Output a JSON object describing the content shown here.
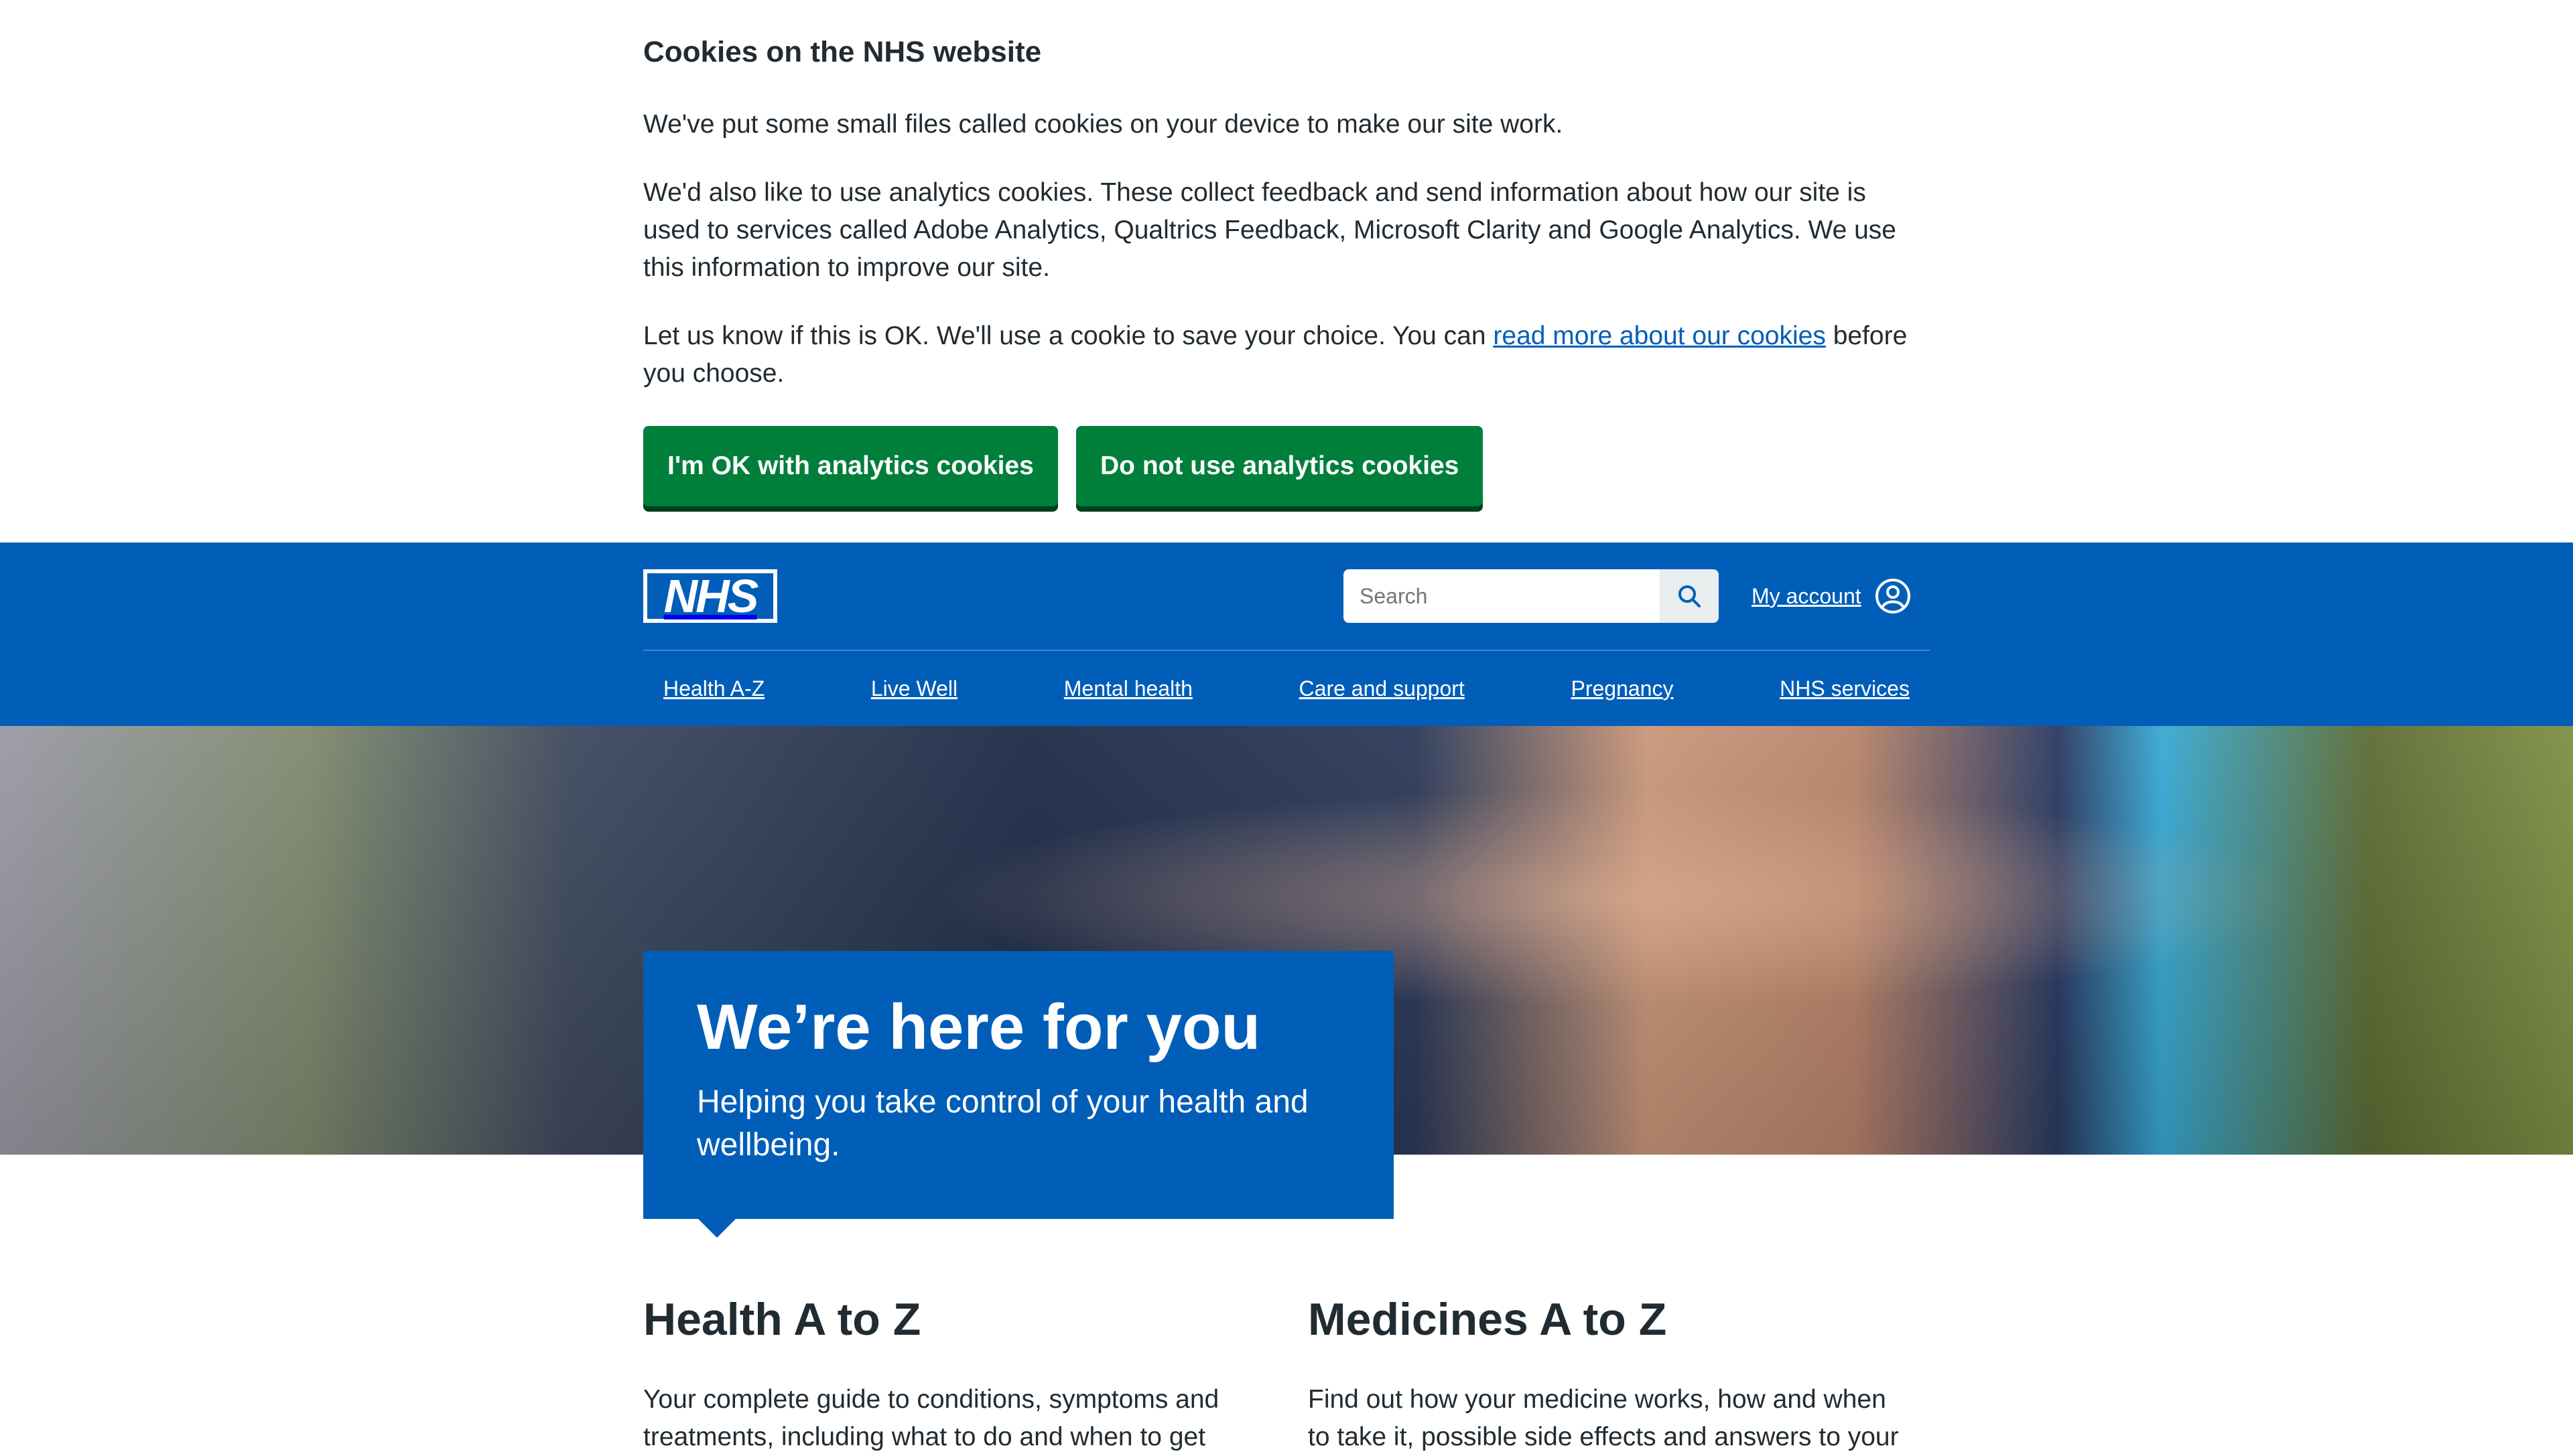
{
  "cookie_banner": {
    "title": "Cookies on the NHS website",
    "para1": "We've put some small files called cookies on your device to make our site work.",
    "para2": "We'd also like to use analytics cookies. These collect feedback and send information about how our site is used to services called Adobe Analytics, Qualtrics Feedback, Microsoft Clarity and Google Analytics. We use this information to improve our site.",
    "para3_before": "Let us know if this is OK. We'll use a cookie to save your choice. You can ",
    "para3_link": "read more about our cookies",
    "para3_after": " before you choose.",
    "accept_label": "I'm OK with analytics cookies",
    "reject_label": "Do not use analytics cookies"
  },
  "header": {
    "logo_text": "NHS",
    "search_placeholder": "Search",
    "account_label": "My account",
    "nav": [
      {
        "label": "Health A-Z"
      },
      {
        "label": "Live Well"
      },
      {
        "label": "Mental health"
      },
      {
        "label": "Care and support"
      },
      {
        "label": "Pregnancy"
      },
      {
        "label": "NHS services"
      }
    ]
  },
  "hero": {
    "title": "We’re here for you",
    "subtitle": "Helping you take control of your health and wellbeing."
  },
  "cards": [
    {
      "title": "Health A to Z",
      "text": "Your complete guide to conditions, symptoms and treatments, including what to do and when to get"
    },
    {
      "title": "Medicines A to Z",
      "text": "Find out how your medicine works, how and when to take it, possible side effects and answers to your"
    }
  ],
  "colors": {
    "nhs_blue": "#005eb8",
    "nhs_green": "#007f3b",
    "text": "#212b32",
    "link": "#005eb8"
  }
}
